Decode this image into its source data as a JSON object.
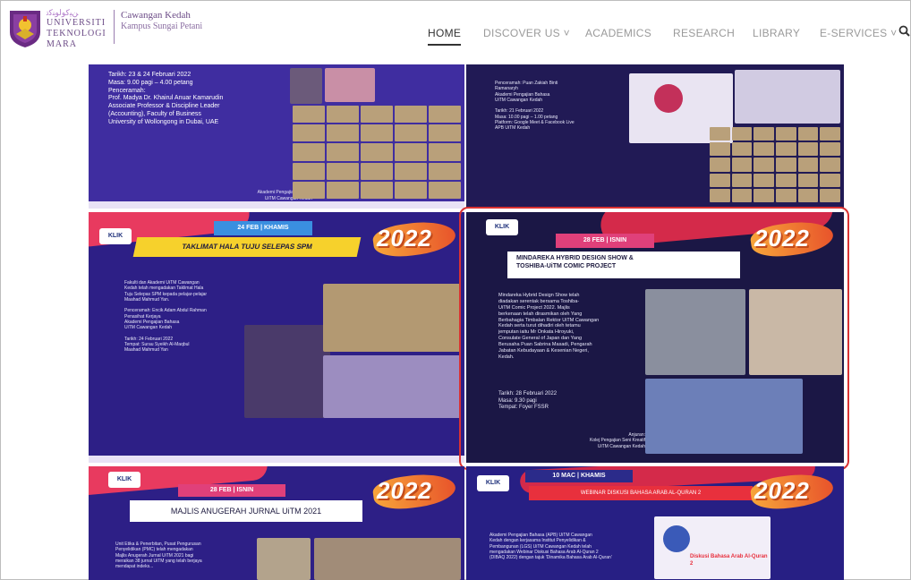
{
  "brand": {
    "jawi": "ﻦﻴﻛﻮﻟﻮﻨﻛﺗ",
    "line1": "UNIVERSITI",
    "line2": "TEKNOLOGI",
    "line3": "MARA",
    "campus_name": "Cawangan Kedah",
    "campus_sub": "Kampus Sungai Petani"
  },
  "nav": {
    "home": "HOME",
    "discover": "DISCOVER US ˅",
    "academics": "ACADEMICS",
    "research": "RESEARCH",
    "library": "LIBRARY",
    "eservices": "E-SERVICES ˅"
  },
  "posters": {
    "p1": {
      "text": "Tarikh: 23 & 24 Februari 2022\nMasa: 9.00 pagi – 4.00 petang\nPenceramah:\nProf. Madya Dr. Khairul Anuar Kamarudin\nAssociate Professor & Discipline Leader\n(Accounting), Faculty of Business\nUniversity of Wollongong in Dubai, UAE",
      "footer": "Anjuran:\nAkademi Pengajian Bahasa\nUiTM Cawangan Kedah"
    },
    "p2": {
      "text": "Penceramah: Puan Zakiah Binti\nRamanaryh\nAkademi Pengajian Bahasa\nUiTM Cawangan Kedah\n\nTarikh: 21 Februari 2022\nMasa: 10.00 pagi – 1.00 petang\nPlatform: Google Meet & Facebook Live\nAPB UiTM Kedah"
    },
    "p3": {
      "badge": "KLIK",
      "date": "24 FEB | KHAMIS",
      "title": "TAKLIMAT HALA TUJU SELEPAS SPM",
      "year": "2022",
      "text": "Fakulti dan Akademi UiTM Cawangan\nKedah telah mengadakan Taklimat Hala\nTuju Selepas SPM kepada pelajar-pelajar\nMaahad Mahmud Yan.\n\nPenceramah: Encik Adam Abdul Rahman\nPenasihat Kerjaya\nAkademi Pengajian Bahasa\nUiTM Cawangan Kedah\n\nTarikh: 24 Februari 2022\nTempat: Surau Syeikh Al-Maqbul\nMaahad Mahmud Yan"
    },
    "p4": {
      "badge": "KLIK",
      "date": "28 FEB | ISNIN",
      "title": "MINDAREKA HYBRID DESIGN SHOW &\nTOSHIBA-UiTM COMIC PROJECT",
      "year": "2022",
      "text": "Mindareka Hybrid Design Show telah\ndiadakan serentak bersama Toshiba-\nUiTM Comic Project 2022. Majlis\nberkenaan telah dirasmikan oleh Yang\nBerbahagia Timbalan Rektor UiTM Cawangan\nKedah serta turut dihadiri oleh tetamu\njemputan iaitu Mr Onkata Hiroyuki,\nConsulate General of Japan dan Yang\nBerusaha Puan Sabrina Masadi, Pengarah\nJabatan Kebudayaan & Kesenian Negeri,\nKedah.",
      "details": "Tarikh: 28 Februari 2022\nMasa: 9.30 pagi\nTempat: Foyer FSSR",
      "footer": "Anjuran:\nKolej Pengajian Seni Kreatif\nUiTM Cawangan Kedah"
    },
    "p5": {
      "badge": "KLIK",
      "date": "28 FEB | ISNIN",
      "title": "MAJLIS ANUGERAH JURNAL UiTM 2021",
      "year": "2022",
      "text": "Unit Etika & Penerbitan, Pusat Pengurusan\nPenyelidikan (PMC) telah mengadakan\nMajlis Anugerah Jurnal UiTM 2021 bagi\nmeraikan 38 jurnal UiTM yang telah berjaya\nmendapat indeks..."
    },
    "p6": {
      "badge": "KLIK",
      "date": "10 MAC | KHAMIS",
      "title": "WEBINAR DISKUSI BAHASA ARAB AL-QURAN 2",
      "year": "2022",
      "text": "Akademi Pengajian Bahasa (APB) UiTM Cawangan\nKedah dengan kerjasama Institut Penyelidikan &\nPembangunan (LGS) UiTM Cawangan Kedah telah\nmengadakan Webinar Diskusi Bahasa Arab Al-Quran 2\n(DIBAQ 2022) dengan tajuk 'Dinamika Bahasa Arab Al-Quran'",
      "poster_title": "Diskusi Bahasa Arab Al-Quran 2"
    }
  }
}
